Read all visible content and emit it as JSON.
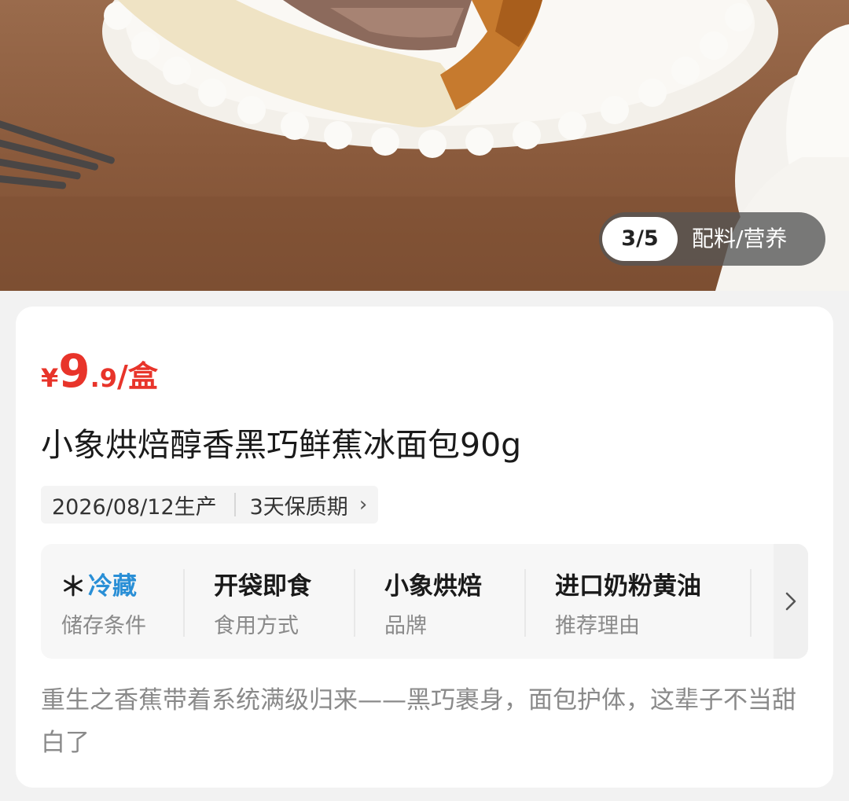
{
  "gallery": {
    "counter": "3/5",
    "tab_label": "配料/营养",
    "image_desc": "bread-on-plate-photo"
  },
  "product": {
    "price": {
      "currency": "¥",
      "integer": "9",
      "decimal": ".9",
      "unit": "/盒",
      "color": "#e8342a"
    },
    "title": "小象烘焙醇香黑巧鲜蕉冰面包90g",
    "production_date": "2026/08/12生产",
    "shelf_life": "3天保质期",
    "attributes": [
      {
        "value": "冷藏",
        "key": "储存条件",
        "icon": "snowflake-icon",
        "color": "#2a8fd6"
      },
      {
        "value": "开袋即食",
        "key": "食用方式"
      },
      {
        "value": "小象烘焙",
        "key": "品牌"
      },
      {
        "value": "进口奶粉黄油",
        "key": "推荐理由"
      }
    ],
    "description": "重生之香蕉带着系统满级归来——黑巧裹身，面包护体，这辈子不当甜白了"
  }
}
